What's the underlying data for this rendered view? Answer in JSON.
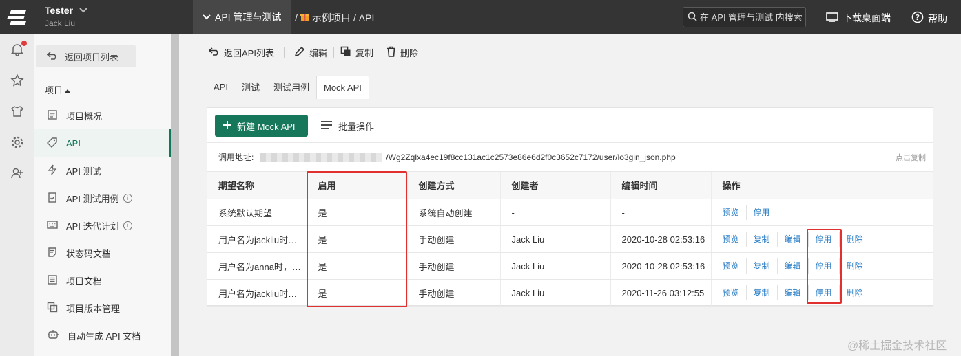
{
  "topbar": {
    "user_name": "Tester",
    "user_sub": "Jack Liu",
    "project_menu": "API 管理与测试",
    "crumb_sep": "/",
    "crumb_project": "示例项目",
    "crumb_sep2": "/",
    "crumb_page": "API",
    "search_placeholder": "在 API 管理与测试 内搜索",
    "download": "下载桌面端",
    "help": "帮助"
  },
  "rail": {
    "icons": [
      "bell-icon",
      "star-icon",
      "shirt-icon",
      "gear-icon",
      "add-user-icon"
    ],
    "notif_color": "#e23b3b"
  },
  "sidebar": {
    "back_label": "返回项目列表",
    "section": "项目",
    "items": [
      {
        "label": "项目概况",
        "icon": "overview-icon"
      },
      {
        "label": "API",
        "icon": "tag-icon"
      },
      {
        "label": "API 测试",
        "icon": "bolt-icon"
      },
      {
        "label": "API 测试用例",
        "icon": "clipboard-check-icon"
      },
      {
        "label": "API 迭代计划",
        "icon": "keyboard-icon"
      },
      {
        "label": "状态码文档",
        "icon": "doc-icon"
      },
      {
        "label": "项目文档",
        "icon": "list-doc-icon"
      },
      {
        "label": "项目版本管理",
        "icon": "copy-icon"
      },
      {
        "label": "自动生成 API 文档",
        "icon": "robot-icon"
      }
    ],
    "active_color": "#12775a"
  },
  "toolbar": {
    "back": "返回API列表",
    "edit": "编辑",
    "copy": "复制",
    "delete": "删除"
  },
  "tabs": [
    "API",
    "测试",
    "测试用例",
    "Mock API"
  ],
  "panel": {
    "new_button": "新建 Mock API",
    "batch": "批量操作",
    "url_label": "调用地址:",
    "url_path": "/Wg2Zqlxa4ec19f8cc131ac1c2573e86e6d2f0c3652c7172/user/lo3gin_json.php",
    "copy_hint": "点击复制",
    "brand_color": "#16775a",
    "link_color": "#2b7fc7"
  },
  "table": {
    "headers": [
      "期望名称",
      "启用",
      "创建方式",
      "创建者",
      "编辑时间",
      "操作"
    ],
    "rows": [
      {
        "name": "系统默认期望",
        "enabled": "是",
        "method": "系统自动创建",
        "creator": "-",
        "time": "-",
        "ops": [
          "预览",
          "停用"
        ]
      },
      {
        "name": "用户名为jackliu时…",
        "enabled": "是",
        "method": "手动创建",
        "creator": "Jack Liu",
        "time": "2020-10-28 02:53:16",
        "ops": [
          "预览",
          "复制",
          "编辑",
          "停用",
          "删除"
        ]
      },
      {
        "name": "用户名为anna时，…",
        "enabled": "是",
        "method": "手动创建",
        "creator": "Jack Liu",
        "time": "2020-10-28 02:53:16",
        "ops": [
          "预览",
          "复制",
          "编辑",
          "停用",
          "删除"
        ]
      },
      {
        "name": "用户名为jackliu时…",
        "enabled": "是",
        "method": "手动创建",
        "creator": "Jack Liu",
        "time": "2020-11-26 03:12:55",
        "ops": [
          "预览",
          "复制",
          "编辑",
          "停用",
          "删除"
        ]
      }
    ]
  },
  "watermark": "@稀土掘金技术社区",
  "highlight_color": "#e03030"
}
